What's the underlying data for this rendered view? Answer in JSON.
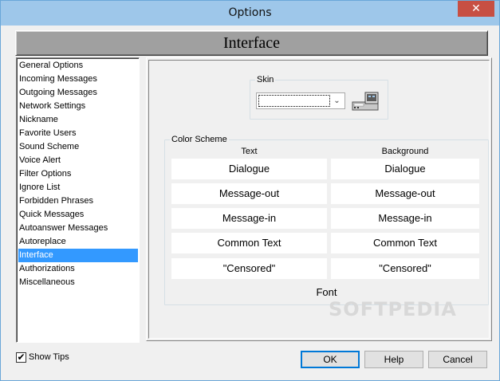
{
  "window": {
    "title": "Options",
    "close_glyph": "✕"
  },
  "header": {
    "title": "Interface"
  },
  "sidebar": {
    "items": [
      {
        "label": "General Options"
      },
      {
        "label": "Incoming Messages"
      },
      {
        "label": "Outgoing Messages"
      },
      {
        "label": "Network Settings"
      },
      {
        "label": "Nickname"
      },
      {
        "label": "Favorite Users"
      },
      {
        "label": "Sound Scheme"
      },
      {
        "label": "Voice Alert"
      },
      {
        "label": "Filter Options"
      },
      {
        "label": "Ignore List"
      },
      {
        "label": "Forbidden Phrases"
      },
      {
        "label": "Quick Messages"
      },
      {
        "label": "Autoanswer Messages"
      },
      {
        "label": "Autoreplace"
      },
      {
        "label": "Interface",
        "selected": true
      },
      {
        "label": "Authorizations"
      },
      {
        "label": "Miscellaneous"
      }
    ]
  },
  "skin": {
    "label": "Skin",
    "selected_value": "",
    "arrow_glyph": "⌄",
    "preview_icon": "skin-preview-icon"
  },
  "color_scheme": {
    "label": "Color Scheme",
    "text_header": "Text",
    "background_header": "Background",
    "rows": [
      {
        "text": "Dialogue",
        "background": "Dialogue"
      },
      {
        "text": "Message-out",
        "background": "Message-out"
      },
      {
        "text": "Message-in",
        "background": "Message-in"
      },
      {
        "text": "Common Text",
        "background": "Common Text"
      },
      {
        "text": "\"Censored\"",
        "background": "\"Censored\""
      }
    ],
    "font_label": "Font"
  },
  "watermark": "SOFTPEDIA",
  "footer": {
    "show_tips_label": "Show Tips",
    "show_tips_checked": true,
    "check_glyph": "✔",
    "ok_label": "OK",
    "help_label": "Help",
    "cancel_label": "Cancel"
  },
  "colors": {
    "titlebar": "#9ec7ea",
    "close_button": "#c74f43",
    "selection": "#3399ff",
    "banner": "#a0a0a0"
  }
}
